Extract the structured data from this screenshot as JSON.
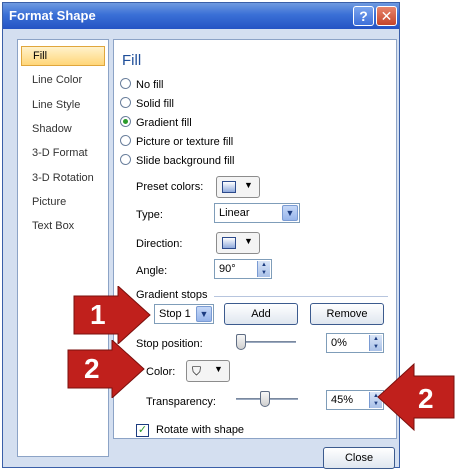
{
  "window": {
    "title": "Format Shape",
    "help_label": "?",
    "close_label": "✕"
  },
  "sidebar": {
    "items": [
      {
        "label": "Fill"
      },
      {
        "label": "Line Color"
      },
      {
        "label": "Line Style"
      },
      {
        "label": "Shadow"
      },
      {
        "label": "3-D Format"
      },
      {
        "label": "3-D Rotation"
      },
      {
        "label": "Picture"
      },
      {
        "label": "Text Box"
      }
    ]
  },
  "fill": {
    "title": "Fill",
    "options": [
      {
        "label": "No fill",
        "selected": false
      },
      {
        "label": "Solid fill",
        "selected": false
      },
      {
        "label": "Gradient fill",
        "selected": true
      },
      {
        "label": "Picture or texture fill",
        "selected": false
      },
      {
        "label": "Slide background fill",
        "selected": false
      }
    ],
    "preset_colors_label": "Preset colors:",
    "type_label": "Type:",
    "type_value": "Linear",
    "direction_label": "Direction:",
    "angle_label": "Angle:",
    "angle_value": "90°",
    "gradient_stops_label": "Gradient stops",
    "stop_value": "Stop 1",
    "add_label": "Add",
    "remove_label": "Remove",
    "stop_position_label": "Stop position:",
    "stop_position_value": "0%",
    "color_label": "Color:",
    "transparency_label": "Transparency:",
    "transparency_value": "45%",
    "rotate_label": "Rotate with shape",
    "rotate_checked": true
  },
  "footer": {
    "close_label": "Close"
  },
  "callouts": {
    "one": "1",
    "two_left": "2",
    "two_right": "2",
    "color": "#c0201c"
  }
}
